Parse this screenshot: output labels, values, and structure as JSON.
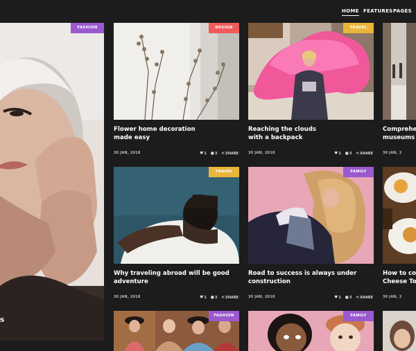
{
  "nav": {
    "items": [
      {
        "label": "HOME",
        "active": true
      },
      {
        "label": "FEATURES",
        "active": false
      },
      {
        "label": "PAGES",
        "active": false
      }
    ]
  },
  "featured": {
    "category": "FASHION",
    "category_color": "#9b59d0",
    "title_fragment": "s"
  },
  "cards": [
    {
      "category": "DESIGN",
      "category_color": "#ef5a5a",
      "title_line1": "Flower home decoration",
      "title_line2": "made easy",
      "date": "30 JAN, 2018",
      "likes": "1",
      "comments": "3",
      "share": "SHARE"
    },
    {
      "category": "TRAVEL",
      "category_color": "#e9b639",
      "title_line1": "Reaching the clouds",
      "title_line2": "with a backpack",
      "date": "30 JAN, 2018",
      "likes": "1",
      "comments": "3",
      "share": "SHARE"
    },
    {
      "category": "",
      "category_color": "",
      "title_line1": "Compreher",
      "title_line2": "museums c",
      "date": "30 JAN, 2",
      "likes": "",
      "comments": "",
      "share": ""
    },
    {
      "category": "TRAVEL",
      "category_color": "#e9b639",
      "title_line1": "Why traveling abroad will be good",
      "title_line2": "adventure",
      "date": "30 JAN, 2018",
      "likes": "1",
      "comments": "3",
      "share": "SHARE"
    },
    {
      "category": "FAMILY",
      "category_color": "#9b59d0",
      "title_line1": "Road to success is always under",
      "title_line2": "construction",
      "date": "30 JAN, 2018",
      "likes": "1",
      "comments": "3",
      "share": "SHARE"
    },
    {
      "category": "",
      "category_color": "",
      "title_line1": "How to coo",
      "title_line2": "Cheese Tot",
      "date": "30 JAN, 2",
      "likes": "",
      "comments": "",
      "share": ""
    },
    {
      "category": "FASHION",
      "category_color": "#9b59d0",
      "title_line1": "",
      "title_line2": "",
      "date": "",
      "likes": "",
      "comments": "",
      "share": ""
    },
    {
      "category": "FAMILY",
      "category_color": "#9b59d0",
      "title_line1": "",
      "title_line2": "",
      "date": "",
      "likes": "",
      "comments": "",
      "share": ""
    }
  ],
  "icons": {
    "like": "heart-icon",
    "comment": "comment-icon",
    "share": "share-icon"
  }
}
